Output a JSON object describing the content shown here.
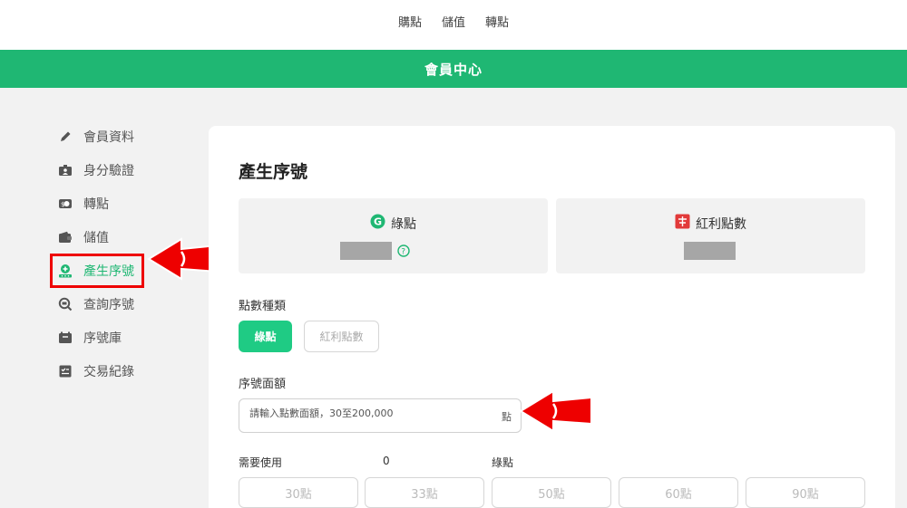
{
  "topnav": [
    "購點",
    "儲值",
    "轉點"
  ],
  "banner": "會員中心",
  "sidebar": {
    "items": [
      {
        "label": "會員資料",
        "icon": "pencil-icon"
      },
      {
        "label": "身分驗證",
        "icon": "id-card-icon"
      },
      {
        "label": "轉點",
        "icon": "transfer-icon"
      },
      {
        "label": "儲值",
        "icon": "wallet-icon"
      },
      {
        "label": "產生序號",
        "icon": "generate-code-icon",
        "active": true
      },
      {
        "label": "查詢序號",
        "icon": "search-code-icon"
      },
      {
        "label": "序號庫",
        "icon": "code-library-icon"
      },
      {
        "label": "交易紀錄",
        "icon": "transaction-list-icon"
      }
    ]
  },
  "main": {
    "title": "產生序號",
    "green_points": {
      "label": "綠點",
      "icon": "g-logo-icon",
      "help_icon": "help-circle-icon"
    },
    "bonus_points": {
      "label": "紅利點數",
      "icon": "bonus-points-icon"
    },
    "point_type_label": "點數種類",
    "point_type_options": [
      "綠點",
      "紅利點數"
    ],
    "selected_point_type": "綠點",
    "serial_amount_label": "序號面額",
    "serial_amount_placeholder": "請輸入點數面額，30至200,000",
    "serial_amount_unit": "點",
    "need_use_label": "需要使用",
    "need_use_value": "0",
    "need_use_unit": "綠點",
    "quick_amounts": [
      "30點",
      "33點",
      "50點",
      "60點",
      "90點"
    ]
  },
  "colors": {
    "brand_green": "#1fb773",
    "button_green": "#1fcb84",
    "annotation_red": "#e00000"
  }
}
